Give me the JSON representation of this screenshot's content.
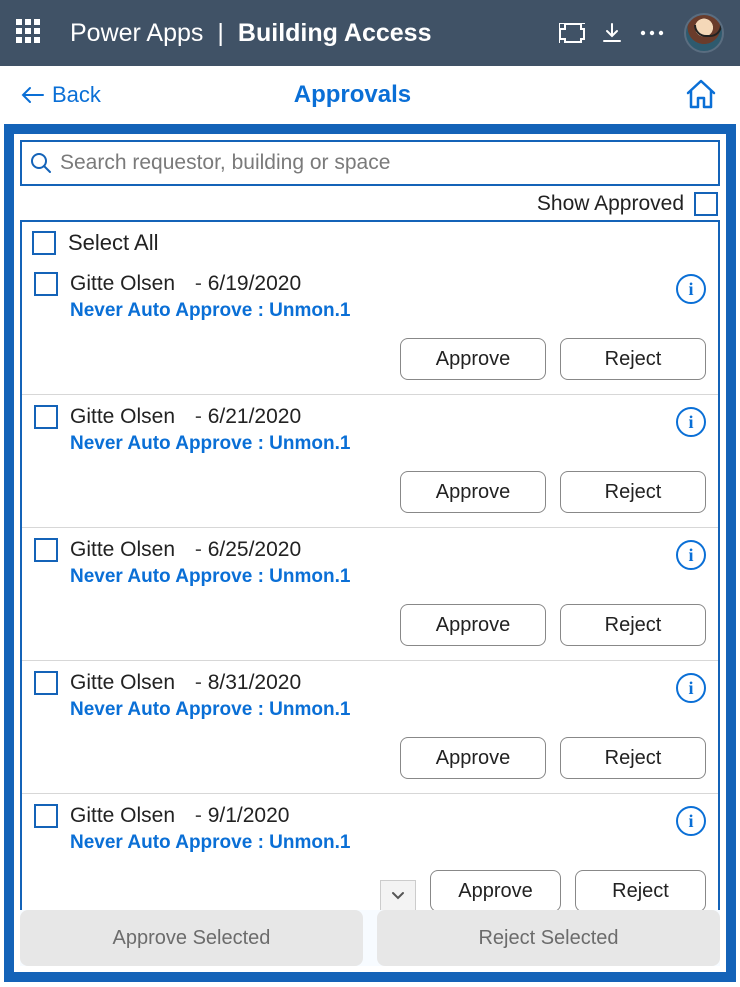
{
  "titlebar": {
    "app": "Power Apps",
    "screen": "Building Access"
  },
  "subheader": {
    "back": "Back",
    "title": "Approvals"
  },
  "search": {
    "placeholder": "Search requestor, building or space"
  },
  "toggles": {
    "show_approved": "Show Approved",
    "select_all": "Select All"
  },
  "buttons": {
    "approve": "Approve",
    "reject": "Reject",
    "approve_selected": "Approve Selected",
    "reject_selected": "Reject Selected"
  },
  "requests": [
    {
      "name": "Gitte Olsen",
      "date": "6/19/2020",
      "policy": "Never Auto Approve : Unmon.1"
    },
    {
      "name": "Gitte Olsen",
      "date": "6/21/2020",
      "policy": "Never Auto Approve : Unmon.1"
    },
    {
      "name": "Gitte Olsen",
      "date": "6/25/2020",
      "policy": "Never Auto Approve : Unmon.1"
    },
    {
      "name": "Gitte Olsen",
      "date": "8/31/2020",
      "policy": "Never Auto Approve : Unmon.1"
    },
    {
      "name": "Gitte Olsen",
      "date": "9/1/2020",
      "policy": "Never Auto Approve : Unmon.1"
    }
  ]
}
